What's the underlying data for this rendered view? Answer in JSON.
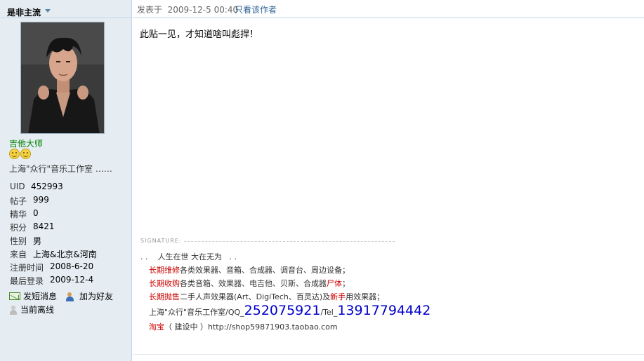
{
  "author": {
    "name": "是非主流",
    "group_title": "吉他大师",
    "stars": 2,
    "studio": "上海\"众行\"音乐工作室 ……",
    "stats": [
      {
        "key": "UID",
        "value": "452993"
      },
      {
        "key": "帖子",
        "value": "999"
      },
      {
        "key": "精华",
        "value": "0"
      },
      {
        "key": "积分",
        "value": "8421"
      },
      {
        "key": "性别",
        "value": "男"
      },
      {
        "key": "来自",
        "value": "上海&北京&河南"
      },
      {
        "key": "注册时间",
        "value": "2008-6-20"
      },
      {
        "key": "最后登录",
        "value": "2009-12-4"
      }
    ],
    "actions": {
      "send_message": "发短消息",
      "add_friend": "加为好友",
      "status": "当前离线"
    }
  },
  "post": {
    "posted_label": "发表于",
    "posted_time": "2009-12-5 00:40",
    "only_author": "只看该作者",
    "message": "此贴一见，才知道啥叫彪捍！"
  },
  "signature": {
    "label": "SIGNATURE:",
    "motto_prefix": ". .",
    "motto": "人生在世  大在无为",
    "motto_suffix": ". .",
    "line1_red": "长期维修",
    "line1_rest": "各类效果器、音箱、合成器、调音台、周边设备；",
    "line2_red": "长期收购",
    "line2_mid": "各类音箱、效果器、电吉他、贝斯、合成器",
    "line2_red2": "尸体",
    "line2_end": "；",
    "line3_red": "长期抛售",
    "line3_mid": "二手人声效果器(Art、DigiTech、百灵达)及",
    "line3_red2": "新手",
    "line3_end": "用效果器；",
    "line4_pre": "上海\"众行\"音乐工作室/QQ_",
    "qq": "252075921",
    "line4_mid": "/Tel_",
    "tel": "13917794442",
    "line5_red": "淘宝",
    "line5_paren": "（ 建设中 ）",
    "line5_url": "http://shop59871903.taobao.com"
  },
  "colors": {
    "sidebar_bg": "#e5edf2",
    "border": "#c2d5e3",
    "link": "#336699",
    "group_title": "#008000",
    "accent_red": "#cc0000",
    "contact_blue": "#0000cc"
  },
  "icons": [
    "dropdown-arrow-icon",
    "smiley-star-icon",
    "message-icon",
    "add-friend-icon",
    "offline-user-icon"
  ]
}
